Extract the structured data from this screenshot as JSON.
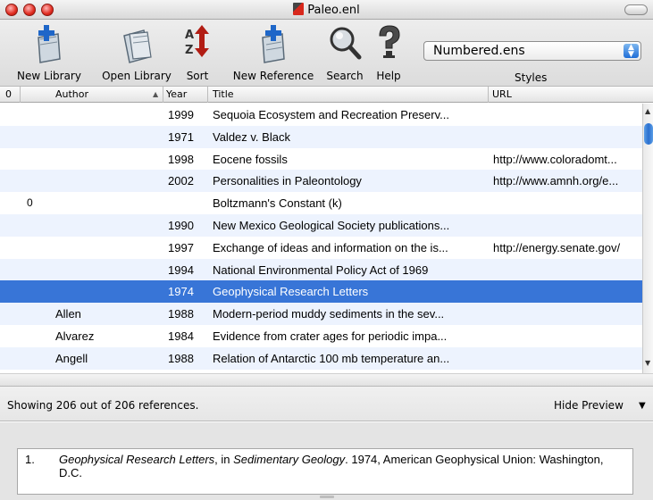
{
  "window": {
    "title": "Paleo.enl"
  },
  "toolbar": {
    "buttons": [
      {
        "label": "New Library"
      },
      {
        "label": "Open Library"
      },
      {
        "label": "Sort"
      },
      {
        "label": "New Reference"
      },
      {
        "label": "Search"
      },
      {
        "label": "Help"
      }
    ],
    "styles_value": "Numbered.ens",
    "styles_label": "Styles"
  },
  "table": {
    "headers": {
      "clip": "0",
      "author": "Author",
      "year": "Year",
      "title": "Title",
      "url": "URL"
    },
    "rows": [
      {
        "clip": "",
        "author": "",
        "year": "1999",
        "title": "Sequoia Ecosystem and Recreation Preserv...",
        "url": ""
      },
      {
        "clip": "",
        "author": "",
        "year": "1971",
        "title": "Valdez v. Black",
        "url": ""
      },
      {
        "clip": "",
        "author": "",
        "year": "1998",
        "title": "Eocene fossils",
        "url": "http://www.coloradomt..."
      },
      {
        "clip": "",
        "author": "",
        "year": "2002",
        "title": "Personalities in Paleontology",
        "url": "http://www.amnh.org/e..."
      },
      {
        "clip": "0",
        "author": "",
        "year": "",
        "title": "Boltzmann's Constant (k)",
        "url": ""
      },
      {
        "clip": "",
        "author": "",
        "year": "1990",
        "title": "New Mexico Geological Society publications...",
        "url": ""
      },
      {
        "clip": "",
        "author": "",
        "year": "1997",
        "title": "Exchange of ideas and information on the is...",
        "url": "http://energy.senate.gov/"
      },
      {
        "clip": "",
        "author": "",
        "year": "1994",
        "title": "National Environmental Policy Act of 1969",
        "url": ""
      },
      {
        "clip": "",
        "author": "",
        "year": "1974",
        "title": "Geophysical Research Letters",
        "url": ""
      },
      {
        "clip": "",
        "author": "Allen",
        "year": "1988",
        "title": "Modern-period muddy sediments in the sev...",
        "url": ""
      },
      {
        "clip": "",
        "author": "Alvarez",
        "year": "1984",
        "title": "Evidence from crater ages for periodic impa...",
        "url": ""
      },
      {
        "clip": "",
        "author": "Angell",
        "year": "1988",
        "title": "Relation of Antarctic 100 mb temperature an...",
        "url": ""
      }
    ],
    "selected_index": 8
  },
  "status": {
    "count_text": "Showing 206 out of 206 references.",
    "hide_preview": "Hide Preview"
  },
  "preview": {
    "number": "1.",
    "title_italic": "Geophysical Research Letters",
    "mid": ", in ",
    "journal_italic": "Sedimentary Geology",
    "rest": ". 1974, American Geophysical Union: Washington, D.C."
  },
  "colors": {
    "selection": "#3875d7",
    "stripe": "#edf3fe"
  }
}
